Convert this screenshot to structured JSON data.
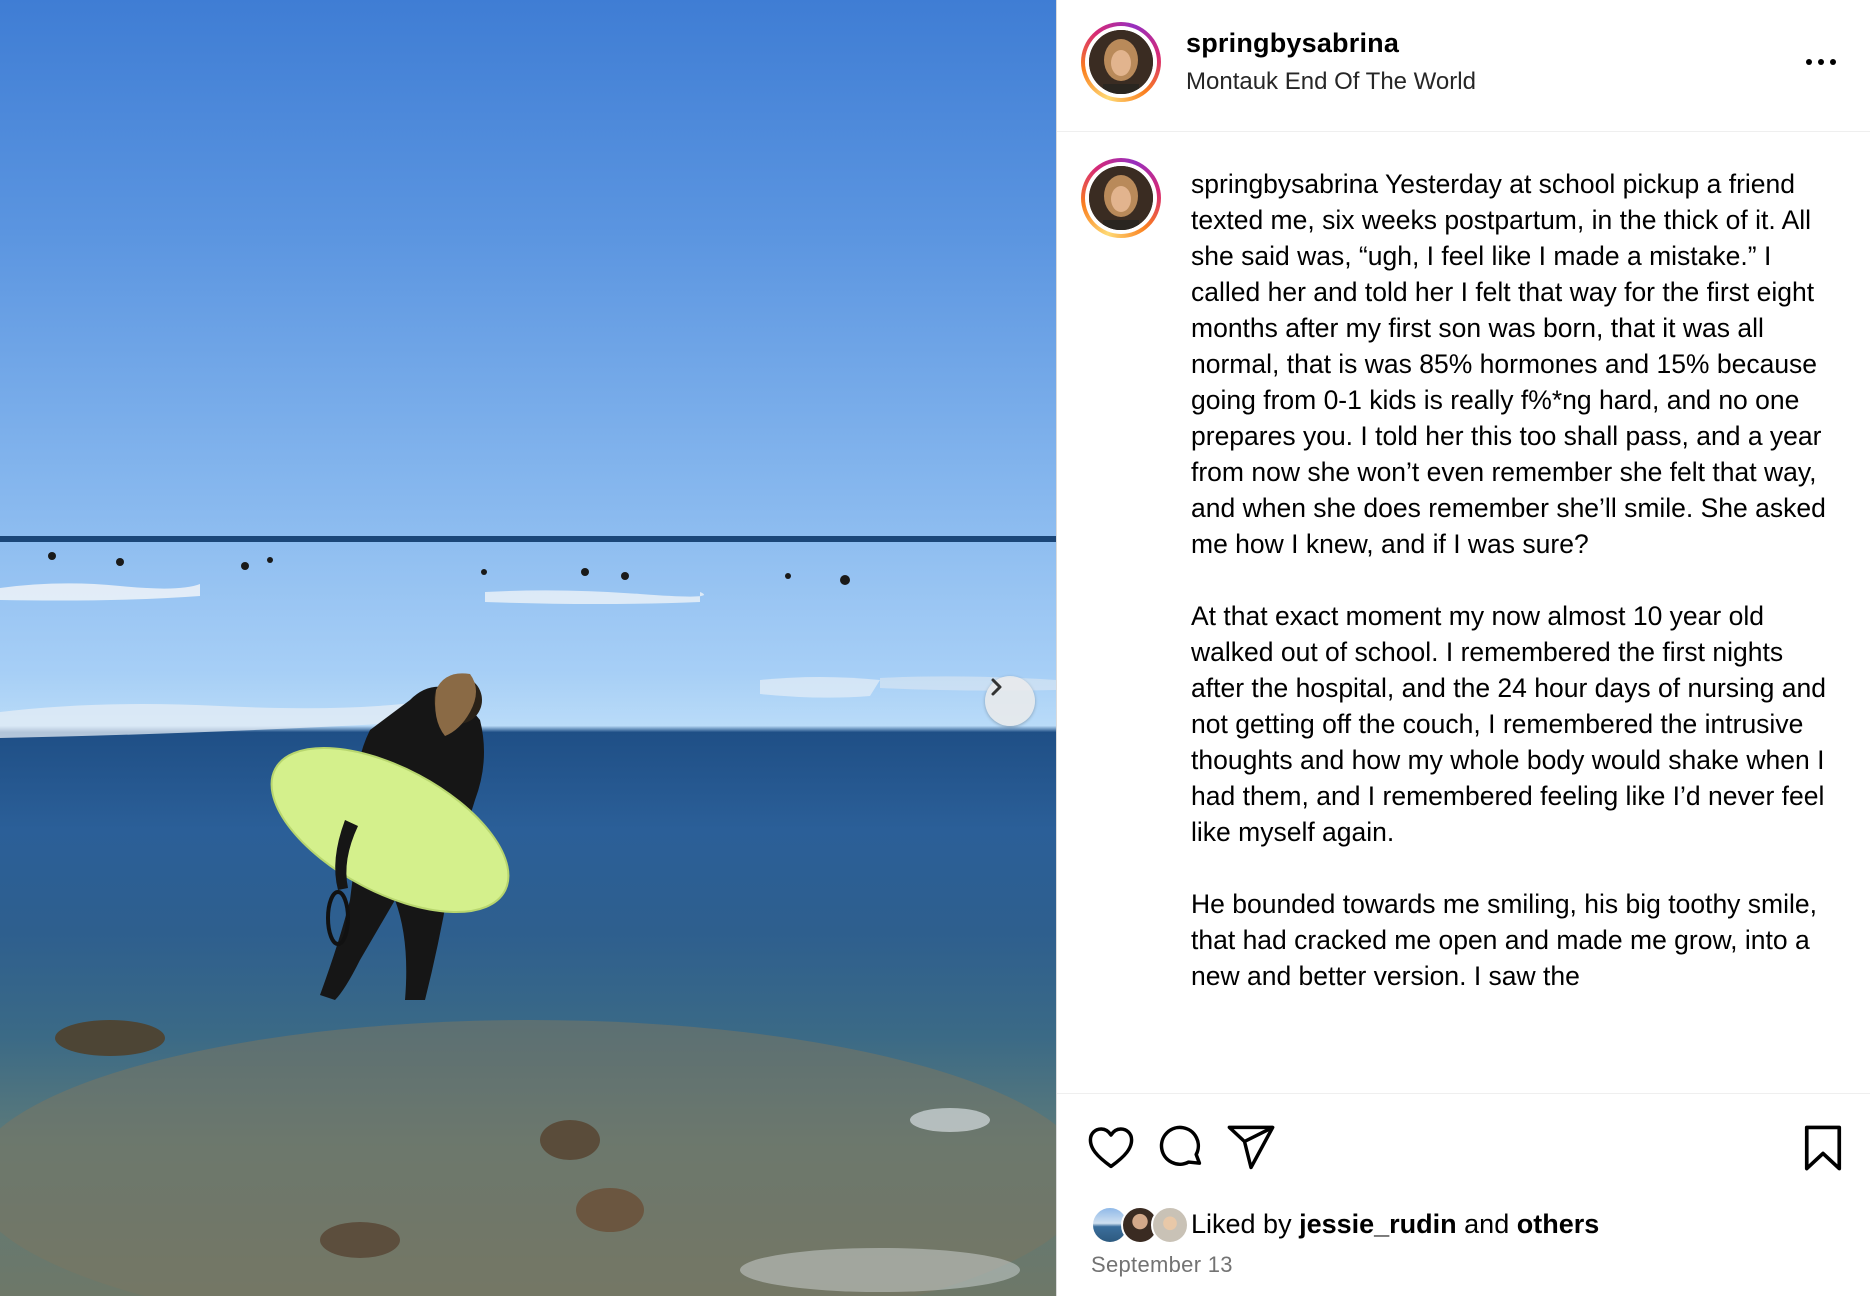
{
  "post": {
    "username": "springbysabrina",
    "location": "Montauk End Of The World"
  },
  "caption": {
    "username": "springbysabrina",
    "text": " Yesterday at school pickup a friend texted me, six weeks postpartum, in the thick of it. All she said was, “ugh, I feel like I made a mistake.” I called her and told her I felt that way for the first eight months after my first son was born, that it was all normal, that is was 85% hormones and 15% because going from 0-1 kids is really f%*ng hard, and no one prepares you. I told her this too shall pass, and a year from now she won’t even remember she felt that way, and when she does remember she’ll smile. She asked me how I knew, and if I was sure?\n\nAt that exact moment my now almost 10 year old walked out of school. I remembered the first nights after the hospital, and the 24 hour days of nursing and not getting off the couch, I remembered the intrusive thoughts and how my whole body would shake when I had them, and I remembered feeling like I’d never feel like myself again.\n\nHe bounded towards me smiling, his big toothy smile, that had cracked me open and made me grow, into a new and better version. I saw the"
  },
  "likes": {
    "prefix": "Liked by ",
    "user": "jessie_rudin",
    "middle": " and ",
    "others": "others"
  },
  "date": "September 13",
  "icons": {
    "more": "more-options-icon",
    "like": "heart-icon",
    "comment": "comment-icon",
    "share": "send-icon",
    "save": "bookmark-icon",
    "next": "chevron-right-icon"
  },
  "colors": {
    "surfboard": "#d4f08c",
    "sky": "#5b95e0",
    "ocean": "#2b5f98",
    "date_gray": "#737373"
  }
}
